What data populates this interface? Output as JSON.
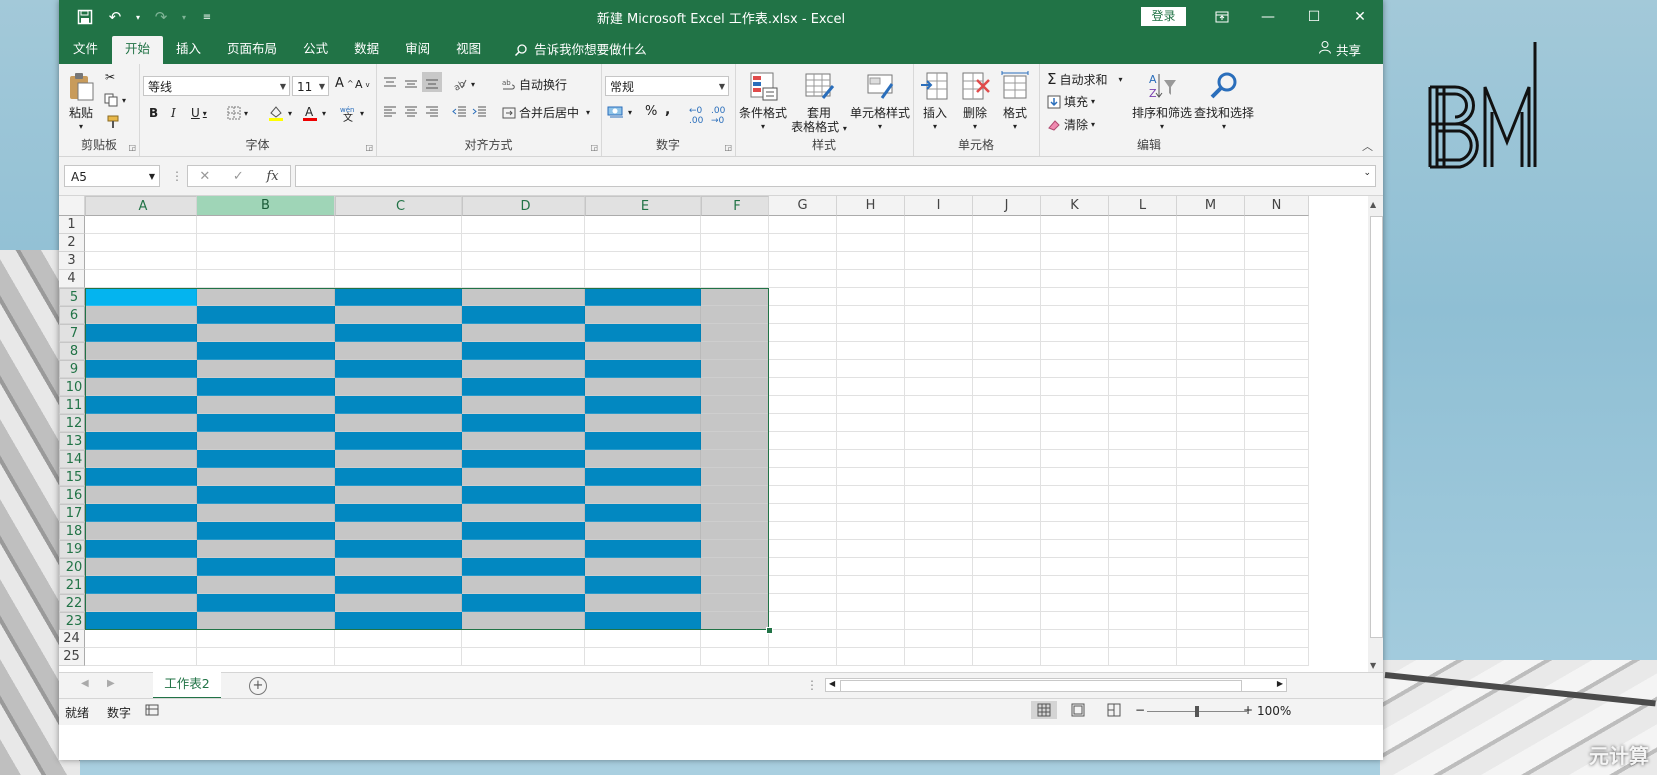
{
  "window": {
    "title": "新建 Microsoft Excel 工作表.xlsx  -  Excel",
    "signin": "登录",
    "share": "共享"
  },
  "tabs": [
    "文件",
    "开始",
    "插入",
    "页面布局",
    "公式",
    "数据",
    "审阅",
    "视图"
  ],
  "tell_me": "告诉我你想要做什么",
  "ribbon": {
    "clipboard": {
      "paste": "粘贴",
      "label": "剪贴板"
    },
    "font": {
      "name": "等线",
      "size": "11",
      "label": "字体"
    },
    "alignment": {
      "wrap": "自动换行",
      "merge": "合并后居中",
      "label": "对齐方式"
    },
    "number": {
      "format": "常规",
      "label": "数字"
    },
    "styles": {
      "conditional": "条件格式",
      "table_format_1": "套用",
      "table_format_2": "表格格式",
      "cell_styles": "单元格样式",
      "label": "样式"
    },
    "cells": {
      "insert": "插入",
      "delete": "删除",
      "format": "格式",
      "label": "单元格"
    },
    "editing": {
      "autosum": "自动求和",
      "fill": "填充",
      "clear": "清除",
      "sort": "排序和筛选",
      "find": "查找和选择",
      "label": "编辑"
    }
  },
  "formula_bar": {
    "name_box": "A5",
    "fx": "fx",
    "value": ""
  },
  "grid": {
    "columns": [
      "A",
      "B",
      "C",
      "D",
      "E",
      "F",
      "G",
      "H",
      "I",
      "J",
      "K",
      "L",
      "M",
      "N"
    ],
    "rows": [
      "1",
      "2",
      "3",
      "4",
      "5",
      "6",
      "7",
      "8",
      "9",
      "10",
      "11",
      "12",
      "13",
      "14",
      "15",
      "16",
      "17",
      "18",
      "19",
      "20",
      "21",
      "22",
      "23",
      "24",
      "25"
    ],
    "fill_colors": {
      "blue": "#0288c1",
      "gray": "#c6c6c6",
      "active": "#04b4ef"
    },
    "active_cell": "A5"
  },
  "sheet": {
    "tab": "工作表2"
  },
  "status": {
    "ready": "就绪",
    "mode": "数字",
    "zoom": "100%"
  },
  "desktop": {
    "watermark": "元计算",
    "logo": "BM"
  },
  "accent": "#217346"
}
